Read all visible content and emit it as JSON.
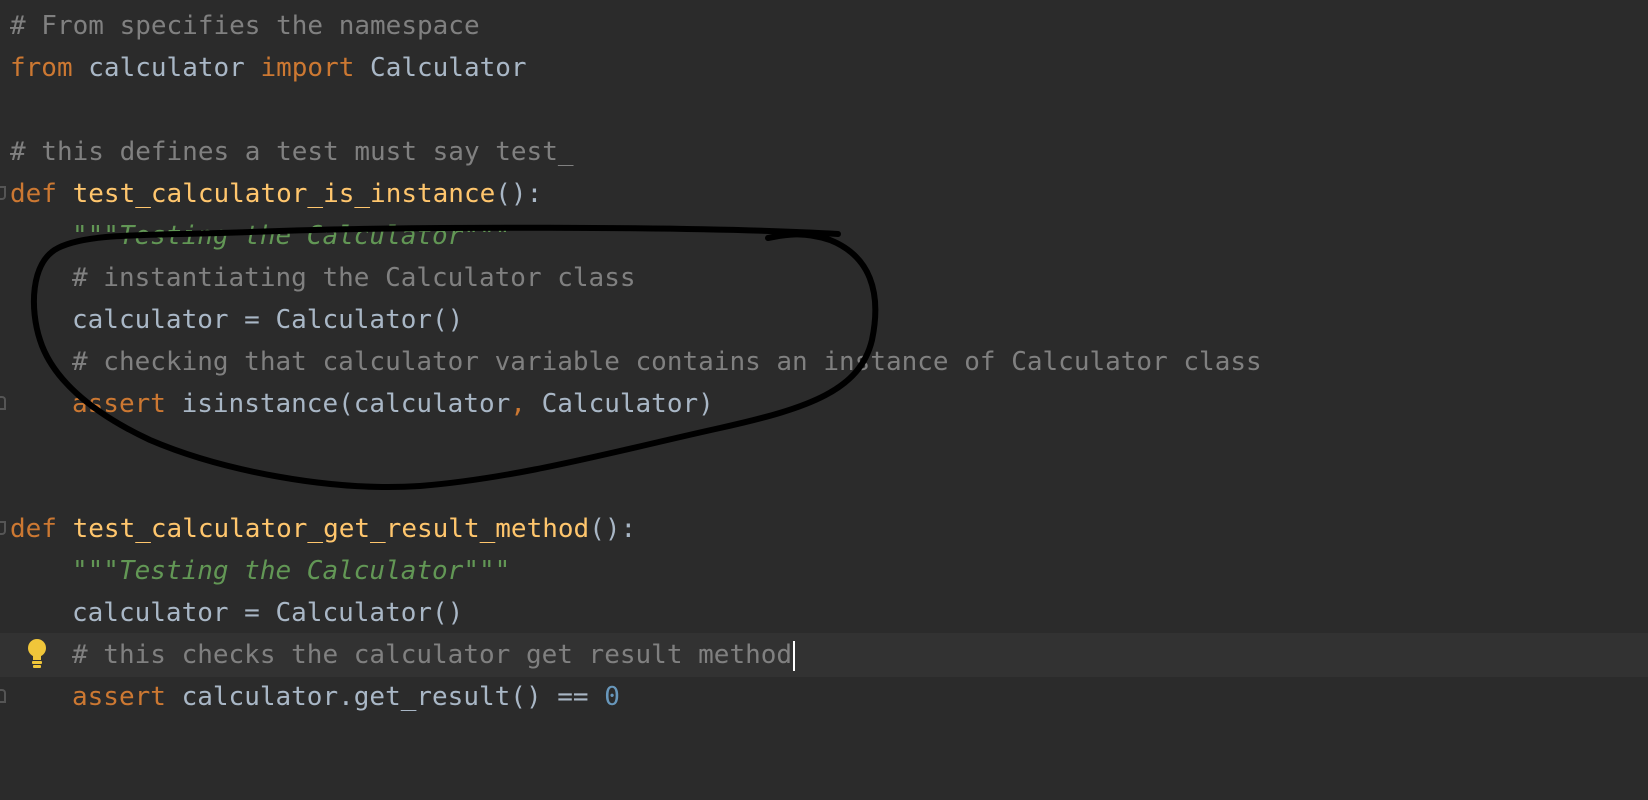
{
  "editor": {
    "language": "python",
    "theme_colors": {
      "background": "#2b2b2b",
      "keyword": "#cc7832",
      "function": "#ffc66d",
      "comment": "#808080",
      "docstring": "#629755",
      "number": "#6897bb",
      "identifier": "#a9b7c6",
      "current_line": "#323232"
    },
    "lines": {
      "l1": {
        "comment": "# From specifies the namespace"
      },
      "l2": {
        "kw_from": "from",
        "module": " calculator ",
        "kw_import": "import",
        "name": " Calculator"
      },
      "l4": {
        "comment": "# this defines a test must say test_"
      },
      "l5": {
        "kw_def": "def",
        "func": " test_calculator_is_instance",
        "tail": "():"
      },
      "l6": {
        "docstring": "\"\"\"Testing the Calculator\"\"\""
      },
      "l7": {
        "comment": "# instantiating the Calculator class"
      },
      "l8": {
        "code": "calculator = Calculator()"
      },
      "l9": {
        "comment": "# checking that calculator variable contains an instance of Calculator class"
      },
      "l10": {
        "kw_assert": "assert",
        "call": " isinstance(calculator",
        "comma": ",",
        "arg": " Calculator)"
      },
      "l13": {
        "kw_def": "def",
        "func": " test_calculator_get_result_method",
        "tail": "():"
      },
      "l14": {
        "docstring": "\"\"\"Testing the Calculator\"\"\""
      },
      "l15": {
        "code": "calculator = Calculator()"
      },
      "l16": {
        "comment": "# this checks the calculator get result method"
      },
      "l17": {
        "kw_assert": "assert",
        "expr": " calculator.get_result() == ",
        "num": "0"
      }
    },
    "annotation": {
      "kind": "hand-drawn circle",
      "color": "#000000"
    },
    "icons": {
      "intention": "lightbulb-icon",
      "fold": "fold-marker-icon"
    }
  }
}
